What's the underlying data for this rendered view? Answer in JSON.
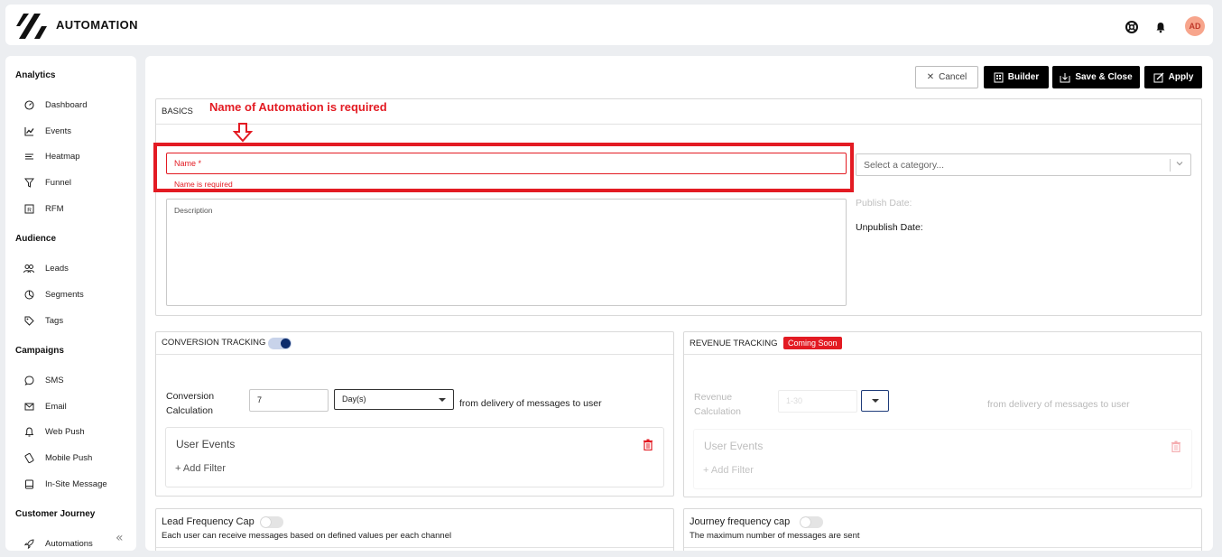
{
  "app": {
    "title": "AUTOMATION",
    "avatar_initials": "AD"
  },
  "sidebar": {
    "sections": [
      {
        "title": "Analytics",
        "items": [
          {
            "label": "Dashboard",
            "icon": "dashboard-icon"
          },
          {
            "label": "Events",
            "icon": "line-chart-icon"
          },
          {
            "label": "Heatmap",
            "icon": "heatmap-icon"
          },
          {
            "label": "Funnel",
            "icon": "funnel-icon"
          },
          {
            "label": "RFM",
            "icon": "rfm-icon"
          }
        ]
      },
      {
        "title": "Audience",
        "items": [
          {
            "label": "Leads",
            "icon": "users-icon"
          },
          {
            "label": "Segments",
            "icon": "pie-icon"
          },
          {
            "label": "Tags",
            "icon": "tag-icon"
          }
        ]
      },
      {
        "title": "Campaigns",
        "items": [
          {
            "label": "SMS",
            "icon": "chat-icon"
          },
          {
            "label": "Email",
            "icon": "mail-icon"
          },
          {
            "label": "Web Push",
            "icon": "bell-icon"
          },
          {
            "label": "Mobile Push",
            "icon": "mobile-push-icon"
          },
          {
            "label": "In-Site Message",
            "icon": "message-icon"
          }
        ]
      },
      {
        "title": "Customer Journey",
        "items": [
          {
            "label": "Automations",
            "icon": "rocket-icon"
          }
        ]
      }
    ]
  },
  "toolbar": {
    "cancel": "Cancel",
    "builder": "Builder",
    "save_close": "Save & Close",
    "apply": "Apply"
  },
  "basics": {
    "heading": "BASICS",
    "annotation": "Name of Automation is required",
    "name_placeholder": "Name *",
    "name_error": "Name is required",
    "description_placeholder": "Description",
    "category_placeholder": "Select a category...",
    "publish_date_label": "Publish Date:",
    "unpublish_date_label": "Unpublish Date:"
  },
  "conversion": {
    "heading": "CONVERSION TRACKING",
    "toggle_on": true,
    "calc_label_1": "Conversion",
    "calc_label_2": "Calculation",
    "value": "7",
    "unit": "Day(s)",
    "suffix": "from delivery of messages to user",
    "user_events": "User Events",
    "add_filter": "+ Add Filter"
  },
  "revenue": {
    "heading": "REVENUE TRACKING",
    "badge": "Coming Soon",
    "calc_label_1": "Revenue",
    "calc_label_2": "Calculation",
    "value_placeholder": "1-30",
    "suffix": "from delivery of messages to user",
    "user_events": "User Events",
    "add_filter": "+ Add Filter"
  },
  "lead_cap": {
    "title": "Lead Frequency Cap",
    "description": "Each user can receive messages based on defined values per each channel",
    "toggle_on": false
  },
  "journey_cap": {
    "title": "Journey frequency cap",
    "description": "The maximum number of messages are sent",
    "toggle_on": false
  },
  "colors": {
    "accent_red": "#e31b23",
    "toggle_navy": "#0c2c6c",
    "avatar_bg": "#f7a58c"
  }
}
